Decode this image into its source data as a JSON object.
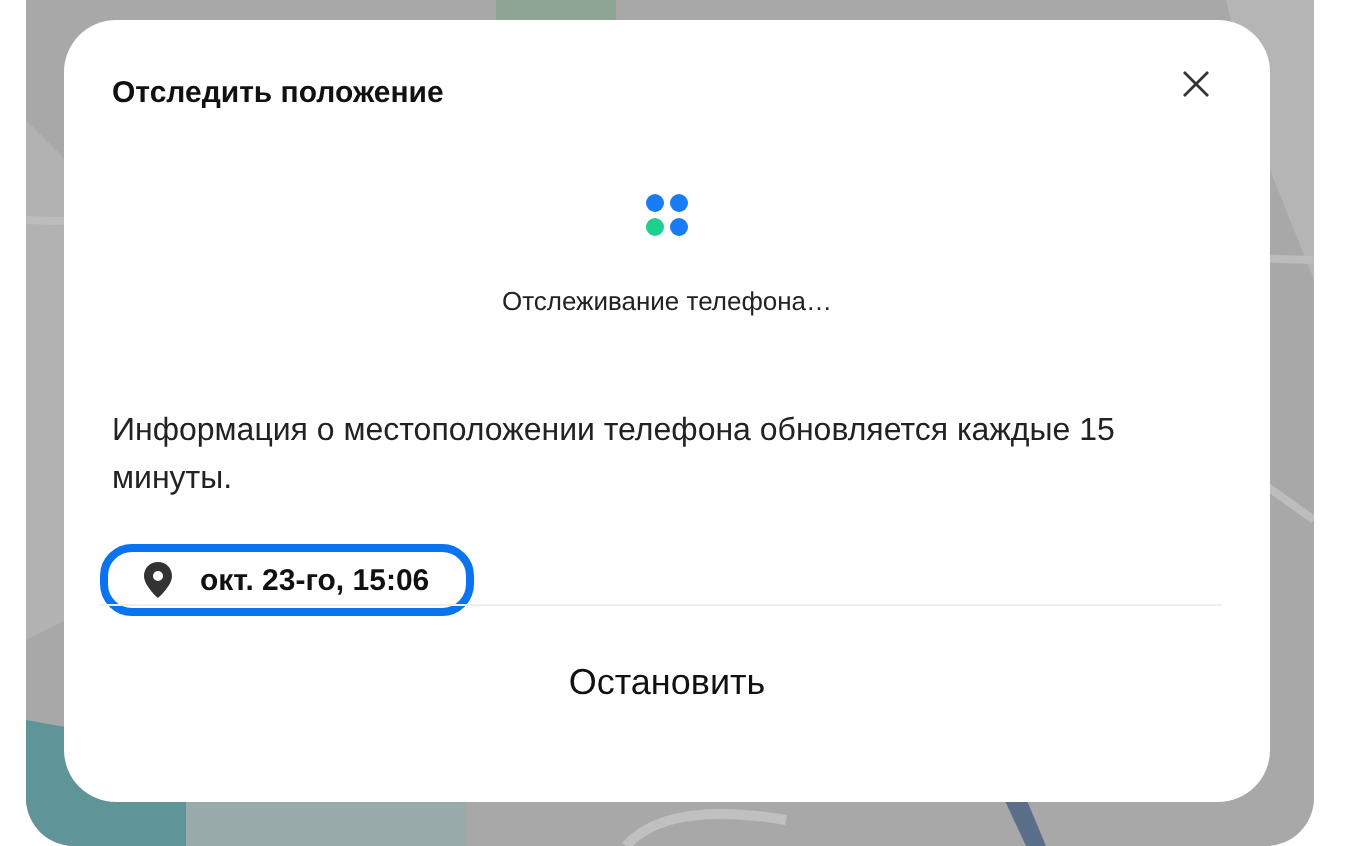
{
  "dialog": {
    "title": "Отследить положение",
    "status": "Отслеживание телефона…",
    "info": "Информация о местоположении телефона обновляется каждые 15 минуты.",
    "location": {
      "time": "окт. 23-го, 15:06",
      "highlighted": true
    },
    "button": "Остановить"
  }
}
